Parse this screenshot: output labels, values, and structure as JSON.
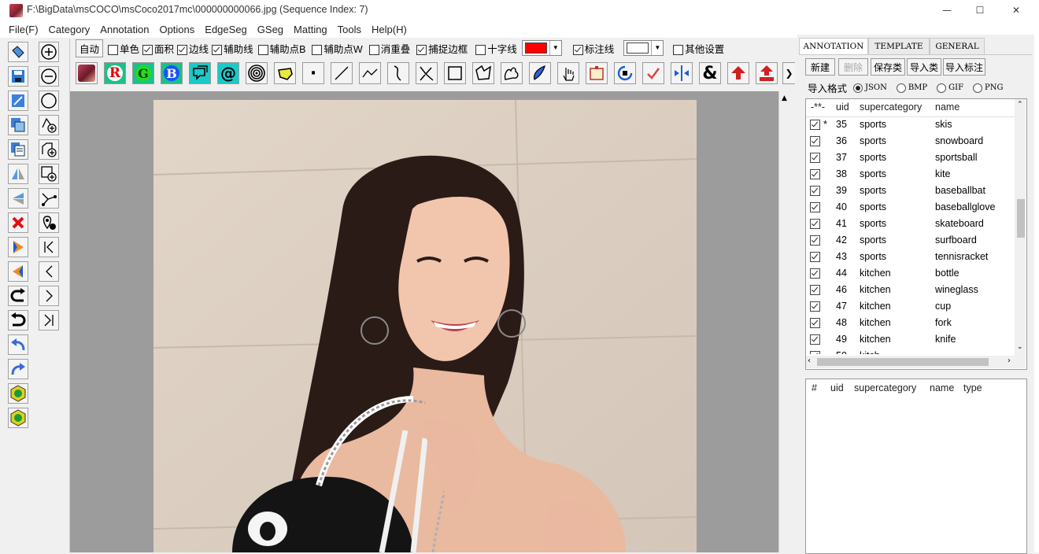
{
  "window": {
    "title": "F:\\BigData\\msCOCO\\msCoco2017mc\\000000000066.jpg (Sequence Index: 7)",
    "min_glyph": "—",
    "max_glyph": "☐",
    "close_glyph": "✕"
  },
  "menu": [
    "File(F)",
    "Category",
    "Annotation",
    "Options",
    "EdgeSeg",
    "GSeg",
    "Matting",
    "Tools",
    "Help(H)"
  ],
  "options": {
    "auto_label": "自动",
    "items": [
      {
        "label": "单色",
        "checked": false
      },
      {
        "label": "面积",
        "checked": true
      },
      {
        "label": "边线",
        "checked": true
      },
      {
        "label": "辅助线",
        "checked": true
      },
      {
        "label": "辅助点B",
        "checked": false
      },
      {
        "label": "辅助点W",
        "checked": false
      },
      {
        "label": "消重叠",
        "checked": false
      },
      {
        "label": "捕捉边框",
        "checked": true
      },
      {
        "label": "十字线",
        "checked": false
      }
    ],
    "crosshair_color": "#ff0000",
    "label_line": {
      "label": "标注线",
      "checked": true
    },
    "label_line_color": "#ffffff",
    "other_settings": {
      "label": "其他设置",
      "checked": false
    }
  },
  "toolbar": {
    "letter_r": "R",
    "letter_g": "G",
    "letter_b": "B",
    "at": "@",
    "amp": "&",
    "dot": "·"
  },
  "tabs": [
    "ANNOTATION",
    "TEMPLATE",
    "GENERAL"
  ],
  "panel_buttons": [
    {
      "label": "新建",
      "enabled": true
    },
    {
      "label": "删除",
      "enabled": false
    },
    {
      "label": "保存类",
      "enabled": true
    },
    {
      "label": "导入类",
      "enabled": true
    },
    {
      "label": "导入标注",
      "enabled": true
    }
  ],
  "import_format": {
    "label": "导入格式",
    "options": [
      {
        "label": "JSON",
        "selected": true
      },
      {
        "label": "BMP",
        "selected": false
      },
      {
        "label": "GIF",
        "selected": false
      },
      {
        "label": "PNG",
        "selected": false
      }
    ]
  },
  "category_table": {
    "headers": [
      "-**-",
      "uid",
      "supercategory",
      "name"
    ],
    "rows": [
      {
        "mark": "*",
        "uid": "35",
        "supercategory": "sports",
        "name": "skis"
      },
      {
        "mark": "",
        "uid": "36",
        "supercategory": "sports",
        "name": "snowboard"
      },
      {
        "mark": "",
        "uid": "37",
        "supercategory": "sports",
        "name": "sportsball"
      },
      {
        "mark": "",
        "uid": "38",
        "supercategory": "sports",
        "name": "kite"
      },
      {
        "mark": "",
        "uid": "39",
        "supercategory": "sports",
        "name": "baseballbat"
      },
      {
        "mark": "",
        "uid": "40",
        "supercategory": "sports",
        "name": "baseballglove"
      },
      {
        "mark": "",
        "uid": "41",
        "supercategory": "sports",
        "name": "skateboard"
      },
      {
        "mark": "",
        "uid": "42",
        "supercategory": "sports",
        "name": "surfboard"
      },
      {
        "mark": "",
        "uid": "43",
        "supercategory": "sports",
        "name": "tennisracket"
      },
      {
        "mark": "",
        "uid": "44",
        "supercategory": "kitchen",
        "name": "bottle"
      },
      {
        "mark": "",
        "uid": "46",
        "supercategory": "kitchen",
        "name": "wineglass"
      },
      {
        "mark": "",
        "uid": "47",
        "supercategory": "kitchen",
        "name": "cup"
      },
      {
        "mark": "",
        "uid": "48",
        "supercategory": "kitchen",
        "name": "fork"
      },
      {
        "mark": "",
        "uid": "49",
        "supercategory": "kitchen",
        "name": "knife"
      }
    ],
    "partial_row": {
      "uid": "50",
      "supercategory": "kitch"
    }
  },
  "annotation_table": {
    "headers": [
      "#",
      "uid",
      "supercategory",
      "name",
      "type"
    ]
  }
}
